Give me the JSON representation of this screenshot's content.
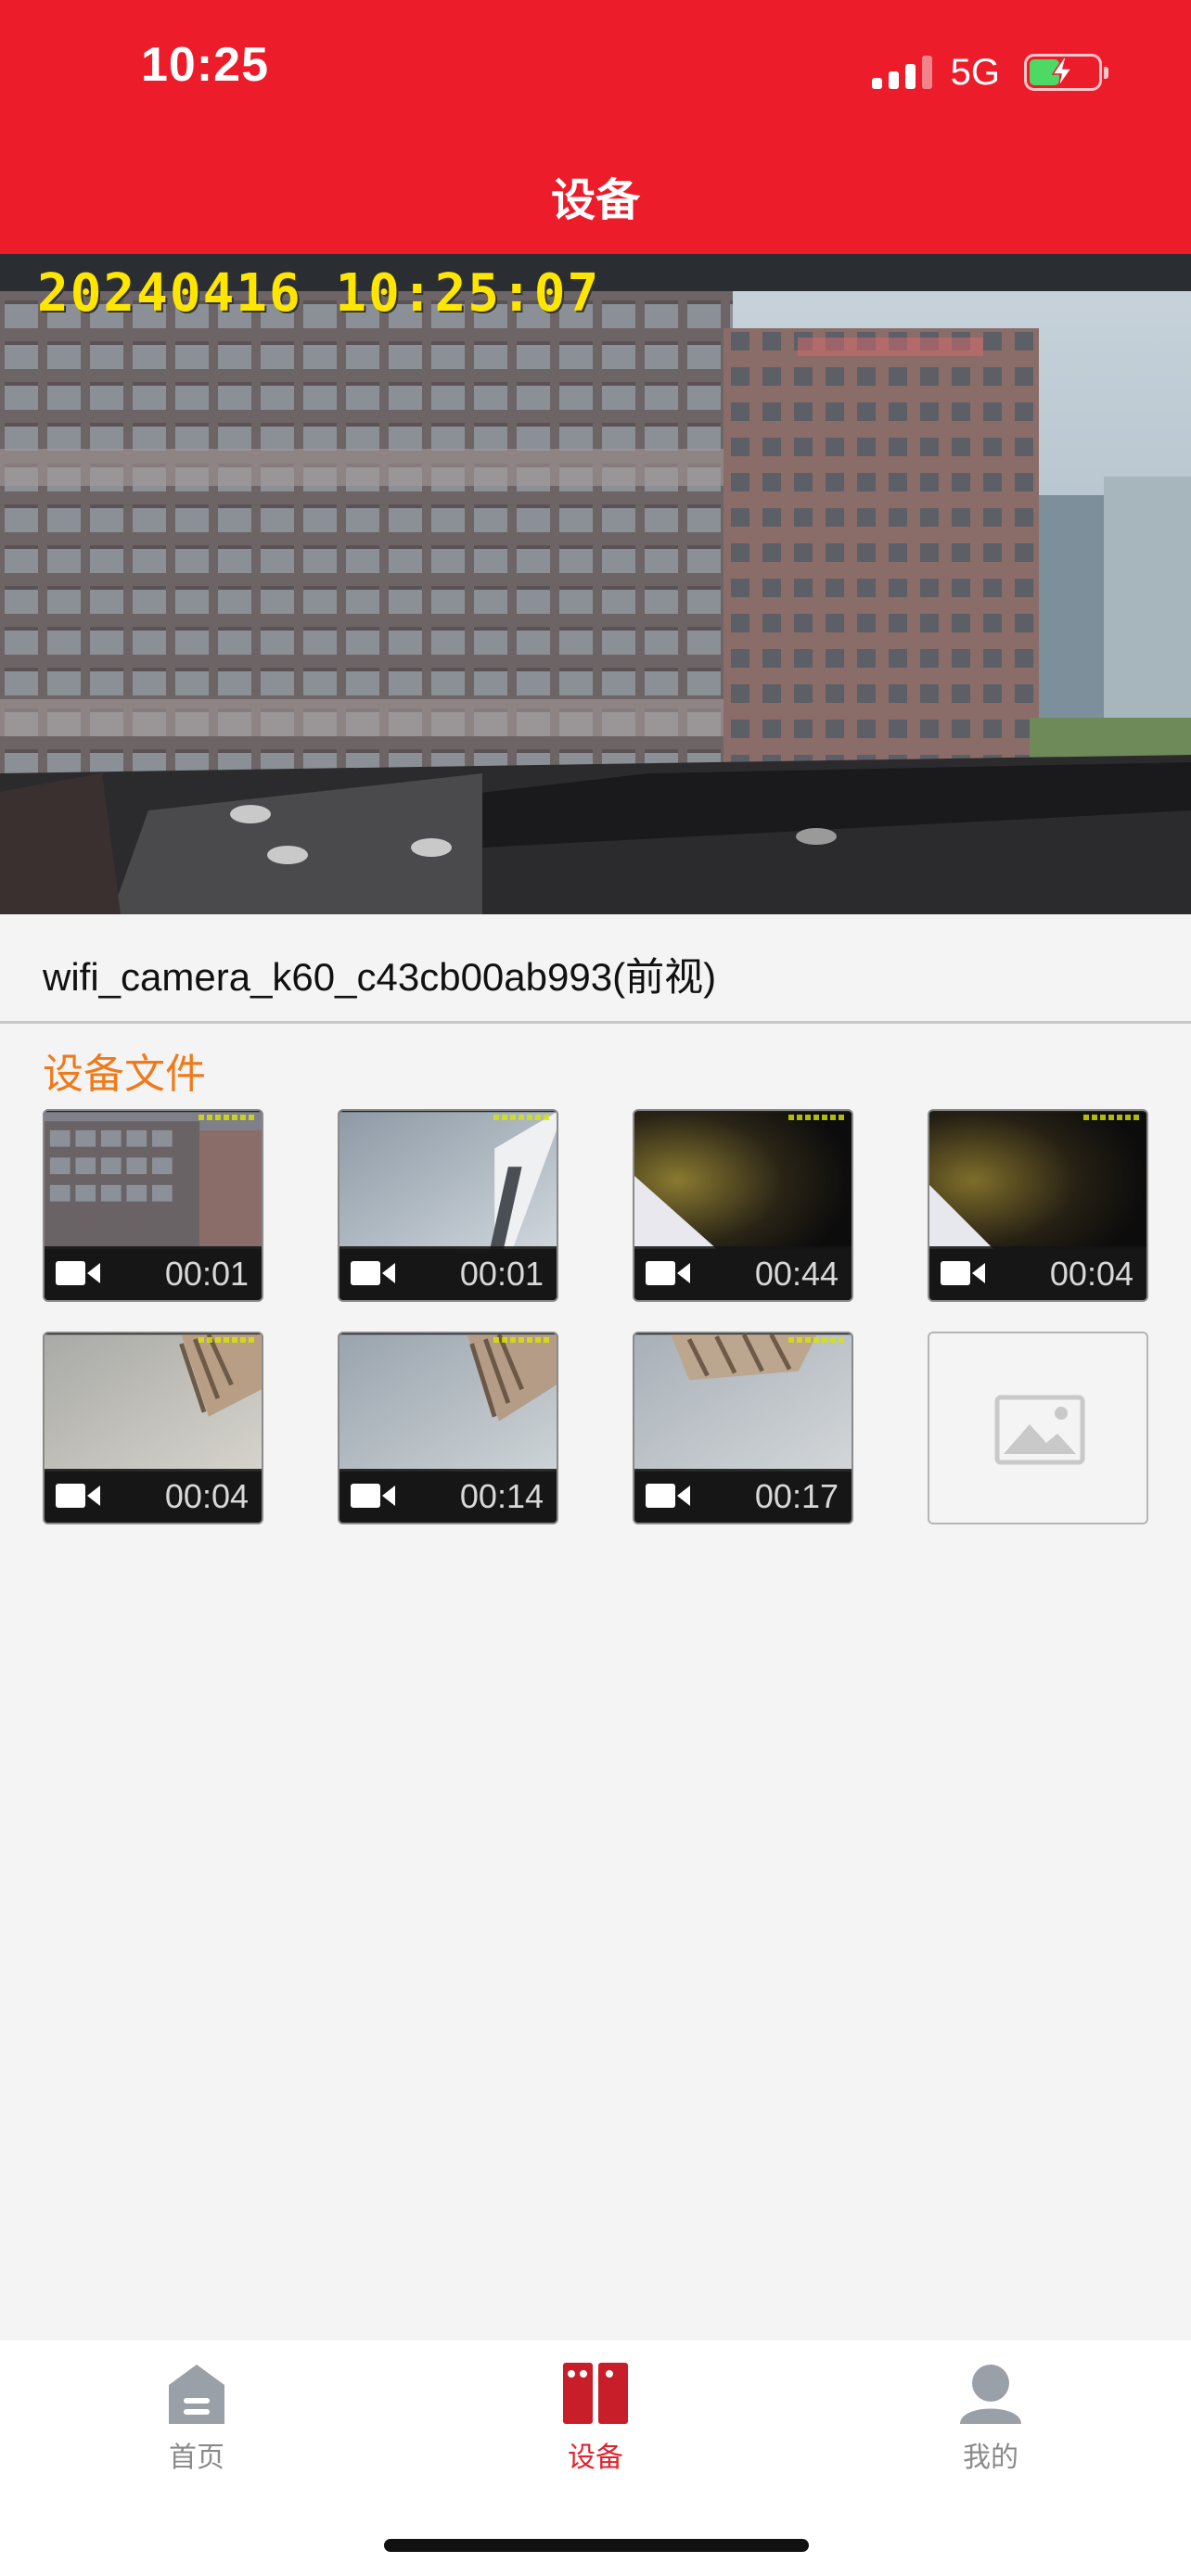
{
  "status_bar": {
    "time": "10:25",
    "network": "5G"
  },
  "header": {
    "title": "设备"
  },
  "camera": {
    "timestamp": "20240416  10:25:07"
  },
  "device": {
    "name": "wifi_camera_k60_c43cb00ab993(前视)"
  },
  "files": {
    "title": "设备文件",
    "items": [
      {
        "duration": "00:01",
        "type": "video",
        "scene": "building"
      },
      {
        "duration": "00:01",
        "type": "video",
        "scene": "wall"
      },
      {
        "duration": "00:44",
        "type": "video",
        "scene": "dark"
      },
      {
        "duration": "00:04",
        "type": "video",
        "scene": "dark"
      },
      {
        "duration": "00:04",
        "type": "video",
        "scene": "ceiling"
      },
      {
        "duration": "00:14",
        "type": "video",
        "scene": "ceiling"
      },
      {
        "duration": "00:17",
        "type": "video",
        "scene": "ceiling"
      },
      {
        "duration": "",
        "type": "image-placeholder",
        "scene": "empty"
      }
    ]
  },
  "tabbar": {
    "home": "首页",
    "devices": "设备",
    "mine": "我的",
    "active_color": "#e0222e",
    "inactive_color": "#8a8a8a"
  },
  "colors": {
    "brand_red": "#ec1c2a",
    "section_orange": "#f07a1a"
  }
}
